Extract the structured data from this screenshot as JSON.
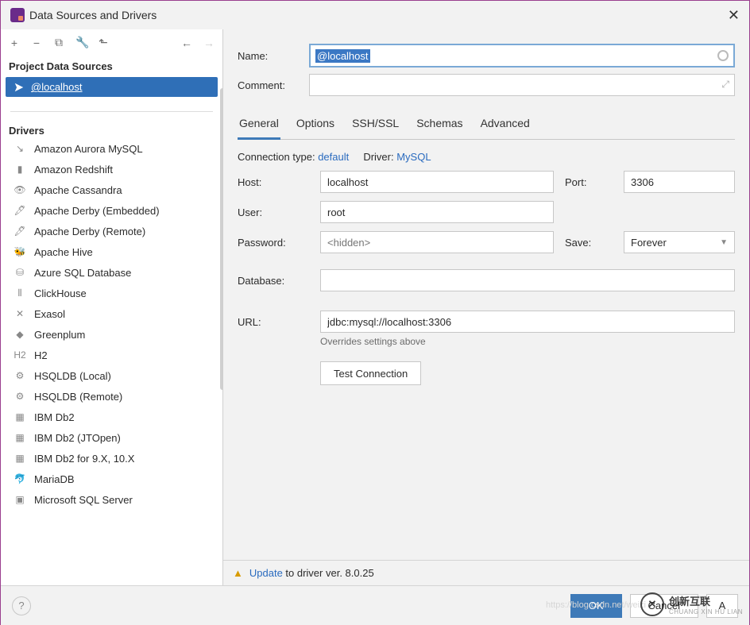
{
  "window": {
    "title": "Data Sources and Drivers"
  },
  "sidebar": {
    "section1": "Project Data Sources",
    "selected": "@localhost",
    "section2": "Drivers",
    "drivers": [
      "Amazon Aurora MySQL",
      "Amazon Redshift",
      "Apache Cassandra",
      "Apache Derby (Embedded)",
      "Apache Derby (Remote)",
      "Apache Hive",
      "Azure SQL Database",
      "ClickHouse",
      "Exasol",
      "Greenplum",
      "H2",
      "HSQLDB (Local)",
      "HSQLDB (Remote)",
      "IBM Db2",
      "IBM Db2 (JTOpen)",
      "IBM Db2 for 9.X, 10.X",
      "MariaDB",
      "Microsoft SQL Server"
    ]
  },
  "form": {
    "name_label": "Name:",
    "name_value": "@localhost",
    "comment_label": "Comment:",
    "tabs": [
      "General",
      "Options",
      "SSH/SSL",
      "Schemas",
      "Advanced"
    ],
    "conn_type_label": "Connection type:",
    "conn_type_value": "default",
    "driver_label": "Driver:",
    "driver_value": "MySQL",
    "host_label": "Host:",
    "host_value": "localhost",
    "port_label": "Port:",
    "port_value": "3306",
    "user_label": "User:",
    "user_value": "root",
    "password_label": "Password:",
    "password_ph": "<hidden>",
    "save_label": "Save:",
    "save_value": "Forever",
    "database_label": "Database:",
    "url_label": "URL:",
    "url_value": "jdbc:mysql://localhost:3306",
    "url_note": "Overrides settings above",
    "test_btn": "Test Connection",
    "update_link": "Update",
    "update_rest": " to driver ver. 8.0.25"
  },
  "footer": {
    "ok": "OK",
    "cancel": "Cancel",
    "apply_cut": "A"
  },
  "watermark": {
    "text": "创新互联",
    "sub": "CHUANG XIN HU LIAN"
  },
  "ghost": "https://blog.csdn.net/weizi"
}
